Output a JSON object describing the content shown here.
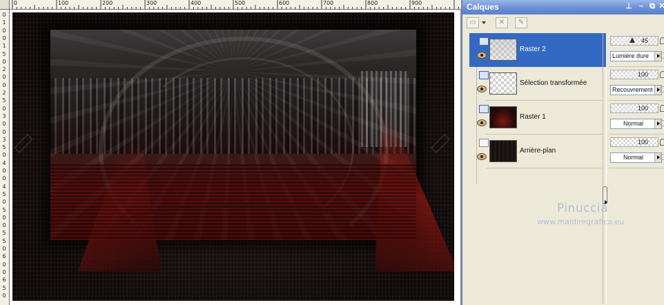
{
  "ruler": {
    "top_labels": [
      "0",
      "100",
      "200",
      "300",
      "400",
      "500",
      "600",
      "700",
      "800",
      "900"
    ],
    "left_labels": [
      "0",
      "1",
      "0",
      "0",
      "1",
      "5",
      "0",
      "2",
      "0",
      "0",
      "2",
      "5",
      "0",
      "3",
      "0",
      "0",
      "3",
      "5",
      "0",
      "4",
      "0",
      "0",
      "4",
      "5",
      "0",
      "5",
      "0",
      "0",
      "5",
      "5",
      "0",
      "6",
      "0",
      "0",
      "6",
      "5",
      "0"
    ]
  },
  "palette": {
    "title": "Calques",
    "window_buttons": [
      "pin-icon",
      "minimize-icon",
      "restore-icon",
      "close-icon"
    ]
  },
  "layers": [
    {
      "name": "Raster 2",
      "selected": true,
      "thumb": "checker-soft",
      "opacity": "45",
      "blend": "Lumière dure"
    },
    {
      "name": "Sélection transformée",
      "selected": false,
      "thumb": "checker",
      "opacity": "100",
      "blend": "Recouvrement"
    },
    {
      "name": "Raster 1",
      "selected": false,
      "thumb": "dark-red",
      "opacity": "100",
      "blend": "Normal"
    },
    {
      "name": "Arrière-plan",
      "selected": false,
      "thumb": "dark",
      "opacity": "100",
      "blend": "Normal"
    }
  ],
  "watermark": {
    "name": "Pinuccia",
    "url": "www.maidiregrafica.eu"
  },
  "colors": {
    "selection": "#3469c3",
    "titlebar": "#6c8fd6",
    "panel_bg": "#ece9d8"
  }
}
